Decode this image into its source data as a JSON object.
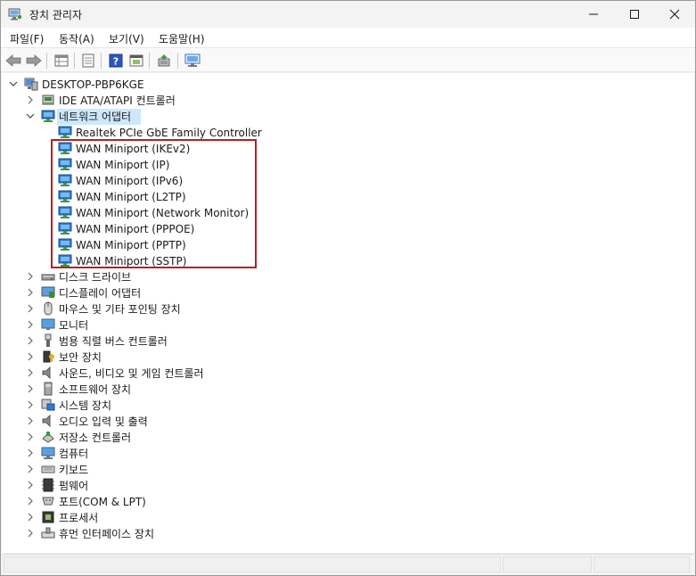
{
  "window": {
    "title": "장치 관리자"
  },
  "menu": [
    "파일(F)",
    "동작(A)",
    "보기(V)",
    "도움말(H)"
  ],
  "toolbar_icons": [
    "back-arrow-icon",
    "forward-arrow-icon",
    "properties-grid-icon",
    "document-icon",
    "help-icon",
    "view-icon",
    "update-driver-icon",
    "monitor-scan-icon"
  ],
  "tree": {
    "root": "DESKTOP-PBP6KGE",
    "categories": [
      {
        "label": "IDE ATA/ATAPI 컨트롤러",
        "icon": "ide-controller-icon",
        "expanded": false
      },
      {
        "label": "네트워크 어댑터",
        "icon": "network-adapter-icon",
        "expanded": true,
        "selected": true,
        "children": [
          "Realtek PCIe GbE Family Controller",
          "WAN Miniport (IKEv2)",
          "WAN Miniport (IP)",
          "WAN Miniport (IPv6)",
          "WAN Miniport (L2TP)",
          "WAN Miniport (Network Monitor)",
          "WAN Miniport (PPPOE)",
          "WAN Miniport (PPTP)",
          "WAN Miniport (SSTP)"
        ]
      },
      {
        "label": "디스크 드라이브",
        "icon": "disk-drive-icon",
        "expanded": false
      },
      {
        "label": "디스플레이 어댑터",
        "icon": "display-adapter-icon",
        "expanded": false
      },
      {
        "label": "마우스 및 기타 포인팅 장치",
        "icon": "mouse-icon",
        "expanded": false
      },
      {
        "label": "모니터",
        "icon": "monitor-icon",
        "expanded": false
      },
      {
        "label": "범용 직렬 버스 컨트롤러",
        "icon": "usb-icon",
        "expanded": false
      },
      {
        "label": "보안 장치",
        "icon": "security-device-icon",
        "expanded": false
      },
      {
        "label": "사운드, 비디오 및 게임 컨트롤러",
        "icon": "speaker-icon",
        "expanded": false
      },
      {
        "label": "소프트웨어 장치",
        "icon": "software-device-icon",
        "expanded": false
      },
      {
        "label": "시스템 장치",
        "icon": "system-device-icon",
        "expanded": false
      },
      {
        "label": "오디오 입력 및 출력",
        "icon": "audio-icon",
        "expanded": false
      },
      {
        "label": "저장소 컨트롤러",
        "icon": "storage-controller-icon",
        "expanded": false
      },
      {
        "label": "컴퓨터",
        "icon": "computer-icon",
        "expanded": false
      },
      {
        "label": "키보드",
        "icon": "keyboard-icon",
        "expanded": false
      },
      {
        "label": "펌웨어",
        "icon": "firmware-icon",
        "expanded": false
      },
      {
        "label": "포트(COM & LPT)",
        "icon": "port-icon",
        "expanded": false
      },
      {
        "label": "프로세서",
        "icon": "processor-icon",
        "expanded": false
      },
      {
        "label": "휴먼 인터페이스 장치",
        "icon": "hid-icon",
        "expanded": false
      }
    ]
  },
  "colors": {
    "selection": "#cce8ff",
    "highlight_box": "#b22222",
    "net_blue": "#2a7bd5"
  }
}
